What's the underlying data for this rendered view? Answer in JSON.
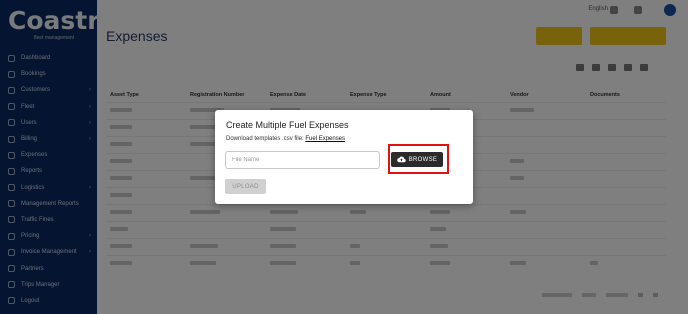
{
  "sidebar": {
    "logo_text": "Coastr",
    "logo_sub": "fleet management",
    "items": [
      {
        "label": "Dashboard",
        "chevron": false
      },
      {
        "label": "Bookings",
        "chevron": false
      },
      {
        "label": "Customers",
        "chevron": true
      },
      {
        "label": "Fleet",
        "chevron": true
      },
      {
        "label": "Users",
        "chevron": true
      },
      {
        "label": "Billing",
        "chevron": true
      },
      {
        "label": "Expenses",
        "chevron": false
      },
      {
        "label": "Reports",
        "chevron": false
      },
      {
        "label": "Logistics",
        "chevron": true
      },
      {
        "label": "Management Reports",
        "chevron": false
      },
      {
        "label": "Traffic Fines",
        "chevron": false
      },
      {
        "label": "Pricing",
        "chevron": true
      },
      {
        "label": "Invoice Management",
        "chevron": true
      },
      {
        "label": "Partners",
        "chevron": false
      },
      {
        "label": "Trips Manager",
        "chevron": false
      },
      {
        "label": "Logout",
        "chevron": false
      }
    ]
  },
  "topbar": {
    "language": "English"
  },
  "page": {
    "title": "Expenses"
  },
  "table": {
    "headers": [
      "Asset Type",
      "Registration Number",
      "Expense Date",
      "Expense Type",
      "Amount",
      "Vendor",
      "Documents"
    ]
  },
  "modal": {
    "title": "Create Multiple Fuel Expenses",
    "download_text": "Download templates .csv file:",
    "download_link": "Fuel Expenses",
    "file_placeholder": "File Name",
    "browse_label": "BROWSE",
    "upload_label": "UPLOAD"
  },
  "colors": {
    "sidebar_bg": "#0b2a63",
    "accent_yellow": "#f0c419",
    "browse_bg": "#2b2b2b",
    "highlight_red": "#e11212"
  }
}
